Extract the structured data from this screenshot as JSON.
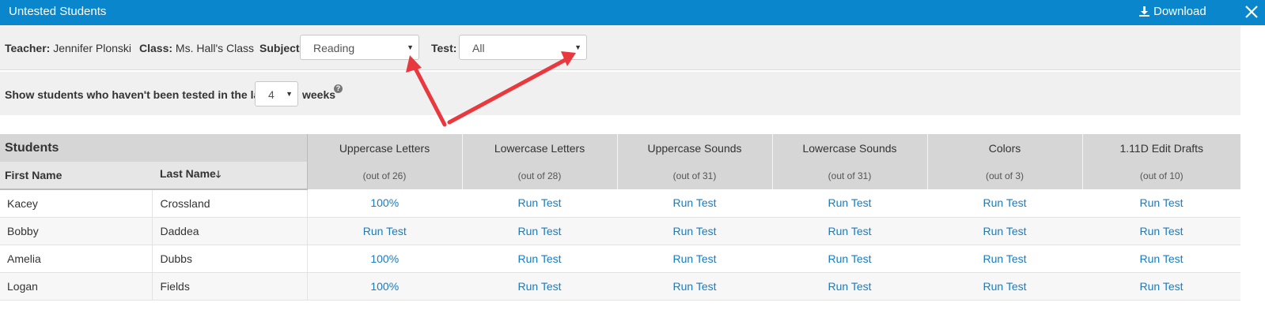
{
  "window": {
    "title": "Untested Students",
    "download_label": "Download"
  },
  "filters": {
    "teacher_label": "Teacher:",
    "teacher_value": "Jennifer Plonski",
    "class_label": "Class:",
    "class_value": "Ms. Hall's Class",
    "subject_label": "Subject:",
    "subject_value": "Reading",
    "test_label": "Test:",
    "test_value": "All"
  },
  "weeks": {
    "label": "Show students who haven't been tested in the last:",
    "value": "4",
    "suffix": "weeks",
    "help": "?"
  },
  "table": {
    "group_header": "Students",
    "first_name_header": "First Name",
    "last_name_header": "Last Name",
    "sort_indicator": "🡓",
    "columns": [
      {
        "name": "Uppercase Letters",
        "out_of": "(out of 26)"
      },
      {
        "name": "Lowercase Letters",
        "out_of": "(out of 28)"
      },
      {
        "name": "Uppercase Sounds",
        "out_of": "(out of 31)"
      },
      {
        "name": "Lowercase Sounds",
        "out_of": "(out of 31)"
      },
      {
        "name": "Colors",
        "out_of": "(out of 3)"
      },
      {
        "name": "1.11D Edit Drafts",
        "out_of": "(out of 10)"
      }
    ],
    "rows": [
      {
        "first": "Kacey",
        "last": "Crossland",
        "cells": [
          "100%",
          "Run Test",
          "Run Test",
          "Run Test",
          "Run Test",
          "Run Test"
        ]
      },
      {
        "first": "Bobby",
        "last": "Daddea",
        "cells": [
          "Run Test",
          "Run Test",
          "Run Test",
          "Run Test",
          "Run Test",
          "Run Test"
        ]
      },
      {
        "first": "Amelia",
        "last": "Dubbs",
        "cells": [
          "100%",
          "Run Test",
          "Run Test",
          "Run Test",
          "Run Test",
          "Run Test"
        ]
      },
      {
        "first": "Logan",
        "last": "Fields",
        "cells": [
          "100%",
          "Run Test",
          "Run Test",
          "Run Test",
          "Run Test",
          "Run Test"
        ]
      }
    ]
  },
  "colors": {
    "header_bar": "#0a87cc",
    "link": "#1a7bc0",
    "annotation_arrow": "#e8393e"
  }
}
